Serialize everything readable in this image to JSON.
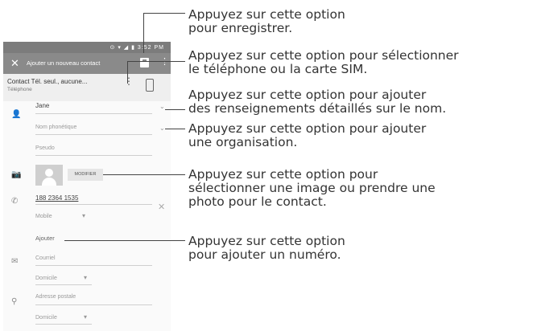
{
  "phone": {
    "status_time": "3:52 PM",
    "toolbar_title": "Ajouter un nouveau contact",
    "account_label": "Contact Tél. seul., aucune...",
    "account_sub": "Téléphone",
    "name_value": "Jane",
    "phonetic_placeholder": "Nom phonétique",
    "nickname_placeholder": "Pseudo",
    "change_photo_label": "MODIFIER",
    "phone_value": "188 2364 1535",
    "phone_type": "Mobile",
    "add_label": "Ajouter",
    "email_placeholder": "Courriel",
    "email_type": "Domicile",
    "address_placeholder": "Adresse postale",
    "address_type": "Domicile"
  },
  "callouts": [
    {
      "l1": "Appuyez sur cette option",
      "l2": "pour enregistrer."
    },
    {
      "l1": "Appuyez sur cette option pour sélectionner",
      "l2": "le téléphone ou la carte SIM."
    },
    {
      "l1": "Appuyez sur cette option pour ajouter",
      "l2": "des renseignements détaillés sur le nom."
    },
    {
      "l1": "Appuyez sur cette option pour ajouter",
      "l2": "une organisation."
    },
    {
      "l1": "Appuyez sur cette option pour",
      "l2": "sélectionner une image ou prendre une",
      "l3": "photo pour le contact."
    },
    {
      "l1": "Appuyez sur cette option",
      "l2": "pour ajouter un numéro."
    }
  ],
  "icons": [
    "close-icon",
    "save-icon",
    "overflow-menu-icon",
    "device-icon",
    "person-icon",
    "camera-icon",
    "phone-icon",
    "clear-icon",
    "email-icon",
    "location-icon",
    "chevron-down-icon"
  ]
}
